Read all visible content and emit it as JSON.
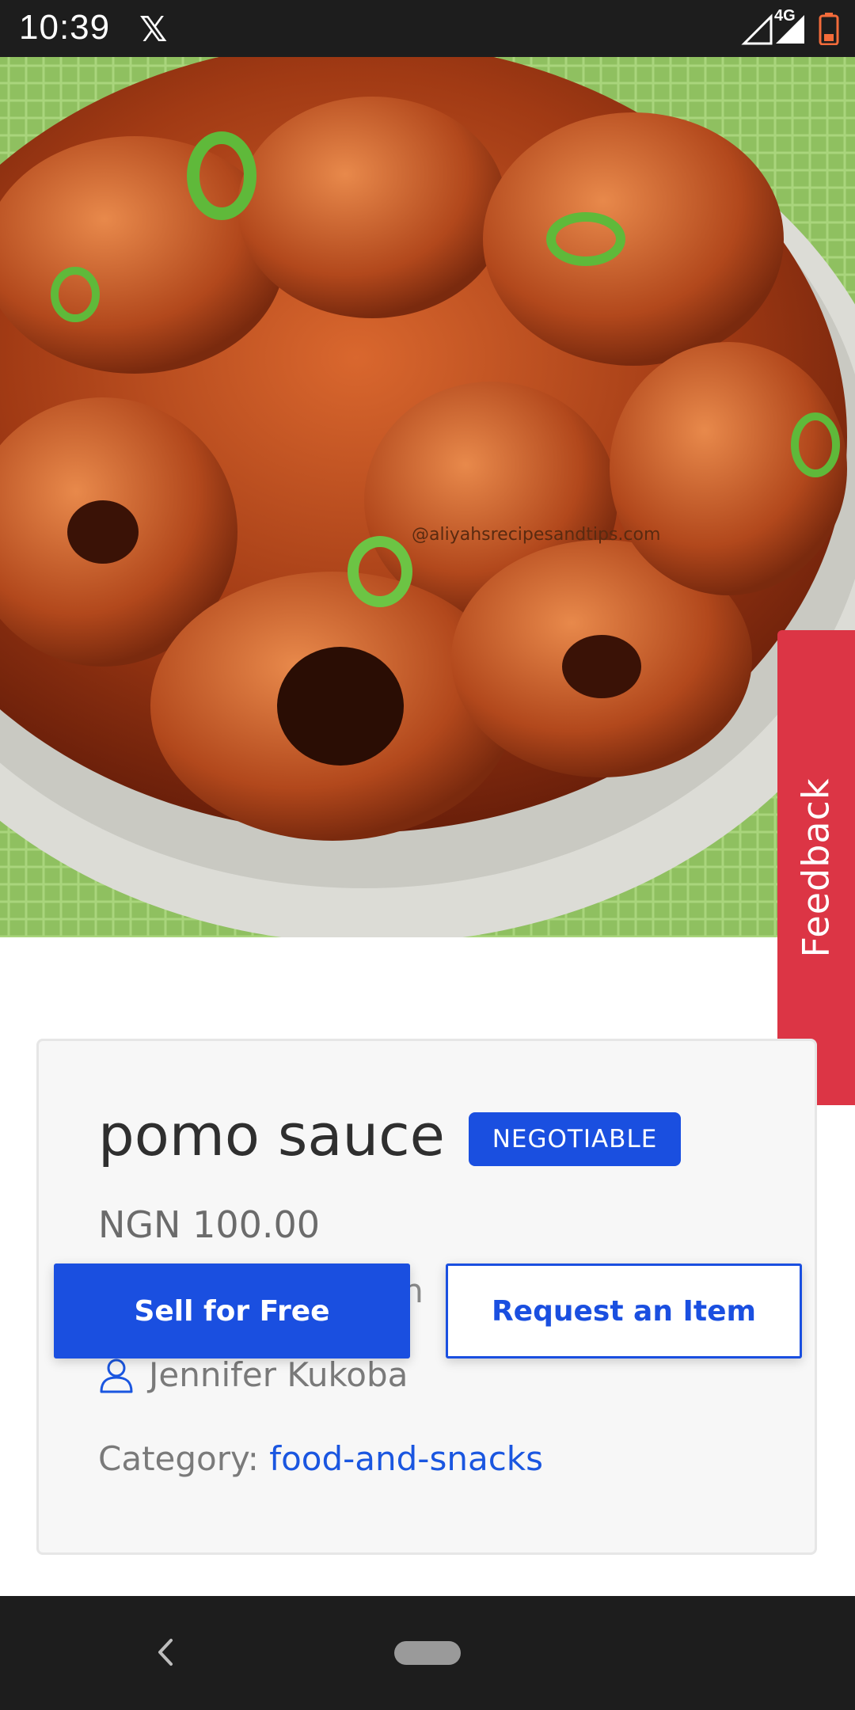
{
  "status_bar": {
    "time": "10:39",
    "x_logo": "𝕏",
    "network": "4G",
    "icons": [
      "x-app-icon",
      "signal-icon",
      "signal-4g-icon",
      "battery-icon"
    ]
  },
  "hero": {
    "watermark": "@aliyahsrecipesandtips.com",
    "image_description_icon": "food-photo"
  },
  "feedback": {
    "label": "Feedback"
  },
  "product": {
    "title": "pomo sauce",
    "badge": "NEGOTIABLE",
    "price": "NGN 100.00",
    "location_fragment": "hin",
    "seller_name": "Jennifer Kukoba",
    "category_label": "Category: ",
    "category_value": "food-and-snacks"
  },
  "actions": {
    "sell_label": "Sell for Free",
    "request_label": "Request an Item"
  },
  "colors": {
    "primary": "#1a4fe0",
    "feedback": "#dc3545",
    "link": "#1a56e0"
  },
  "nav": {
    "icons": [
      "back-icon",
      "home-pill"
    ]
  }
}
